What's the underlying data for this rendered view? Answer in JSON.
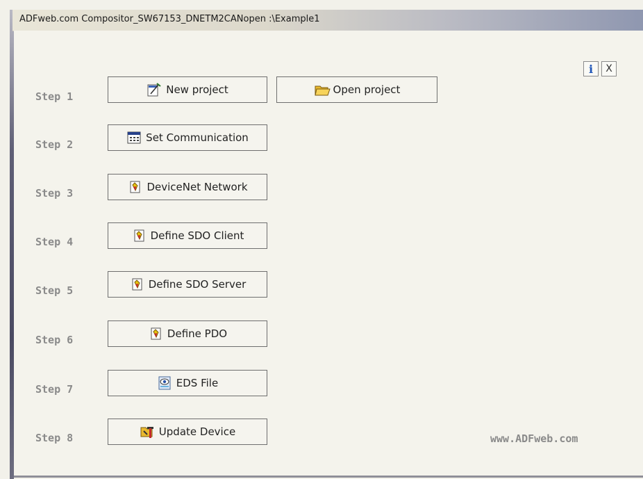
{
  "window": {
    "title": "ADFweb.com Compositor_SW67153_DNETM2CANopen :\\Example1"
  },
  "header": {
    "info_label": "i",
    "close_label": "X"
  },
  "steps": [
    {
      "label": "Step 1",
      "buttons": [
        {
          "label": "New project",
          "icon": "new-project-icon"
        },
        {
          "label": "Open project",
          "icon": "folder-open-icon"
        }
      ]
    },
    {
      "label": "Step 2",
      "buttons": [
        {
          "label": "Set Communication",
          "icon": "communication-icon"
        }
      ]
    },
    {
      "label": "Step 3",
      "buttons": [
        {
          "label": "DeviceNet Network",
          "icon": "document-icon"
        }
      ]
    },
    {
      "label": "Step 4",
      "buttons": [
        {
          "label": "Define SDO Client",
          "icon": "document-icon"
        }
      ]
    },
    {
      "label": "Step 5",
      "buttons": [
        {
          "label": "Define SDO Server",
          "icon": "document-icon"
        }
      ]
    },
    {
      "label": "Step 6",
      "buttons": [
        {
          "label": "Define PDO",
          "icon": "document-icon"
        }
      ]
    },
    {
      "label": "Step 7",
      "buttons": [
        {
          "label": "EDS File",
          "icon": "eye-icon"
        }
      ]
    },
    {
      "label": "Step 8",
      "buttons": [
        {
          "label": "Update Device",
          "icon": "update-device-icon"
        }
      ]
    }
  ],
  "footer": {
    "website": "www.ADFweb.com"
  },
  "colors": {
    "step_label": "#8a8a8a",
    "info_blue": "#1f55b8",
    "panel_bg": "#f4f3ec"
  }
}
